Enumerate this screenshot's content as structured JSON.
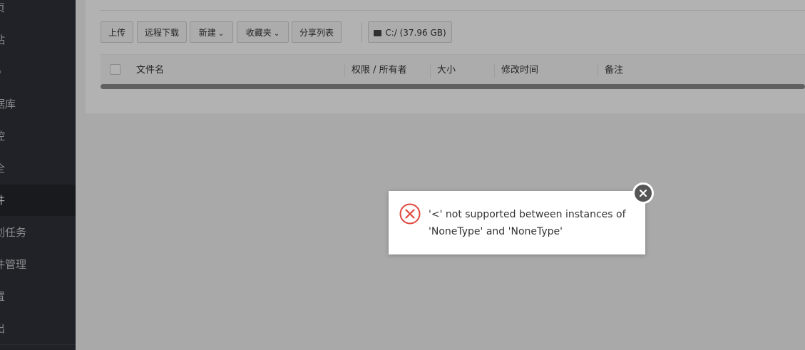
{
  "sidebar": {
    "items": [
      {
        "label": "页"
      },
      {
        "label": "站"
      },
      {
        "label": "p"
      },
      {
        "label": "据库"
      },
      {
        "label": "控"
      },
      {
        "label": "全"
      },
      {
        "label": "件",
        "active": true
      },
      {
        "label": "划任务"
      },
      {
        "label": "件管理"
      },
      {
        "label": "置"
      },
      {
        "label": "出"
      }
    ]
  },
  "toolbar": {
    "upload": "上传",
    "remote_download": "远程下载",
    "new": "新建",
    "favorites": "收藏夹",
    "share_list": "分享列表",
    "disk": "C:/ (37.96 GB)"
  },
  "table": {
    "headers": {
      "filename": "文件名",
      "perm_owner": "权限 / 所有者",
      "size": "大小",
      "mtime": "修改时间",
      "remark": "备注"
    }
  },
  "dialog": {
    "message": "'<' not supported between instances of 'NoneType' and 'NoneType'",
    "icon": "error-circle-icon",
    "close_icon": "close-icon",
    "error_color": "#e0473d"
  }
}
